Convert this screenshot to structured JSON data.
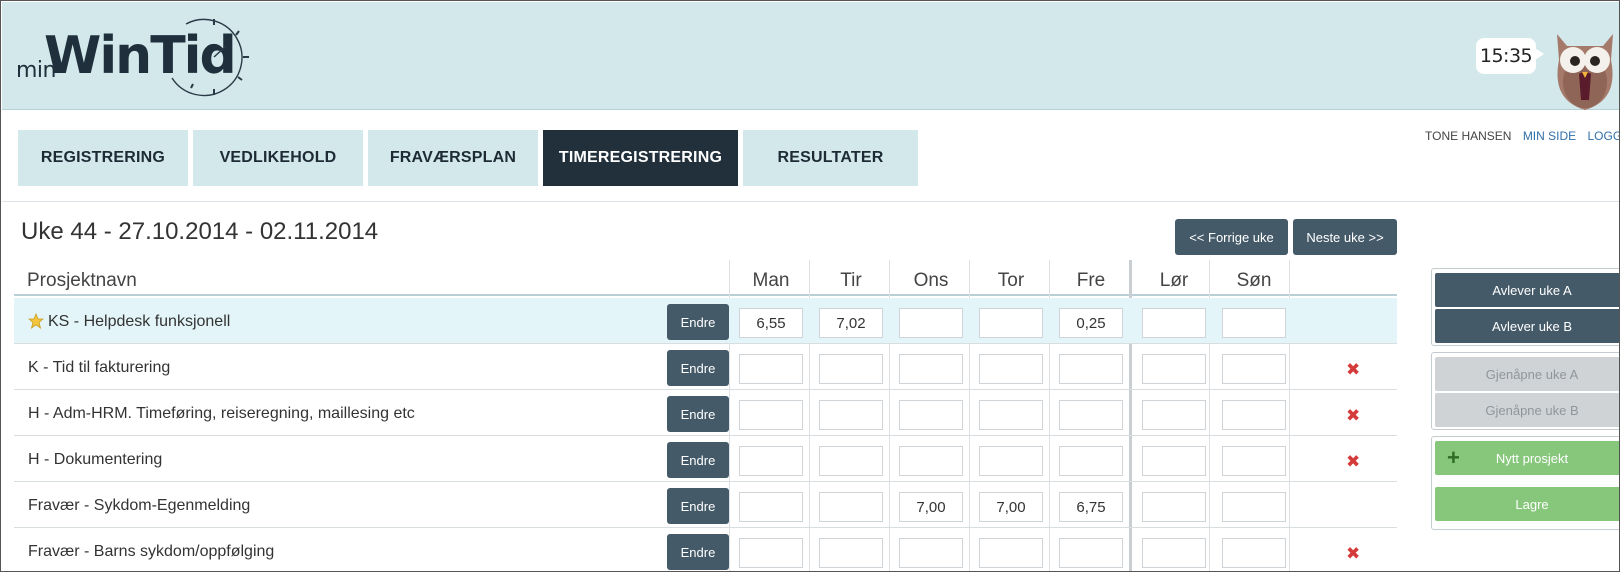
{
  "header": {
    "logo_min": "min",
    "logo_wintid": "WinTid",
    "clock": "15:35"
  },
  "nav": {
    "tabs": [
      {
        "label": "REGISTRERING",
        "active": false
      },
      {
        "label": "VEDLIKEHOLD",
        "active": false
      },
      {
        "label": "FRAVÆRSPLAN",
        "active": false
      },
      {
        "label": "TIMEREGISTRERING",
        "active": true
      },
      {
        "label": "RESULTATER",
        "active": false
      }
    ],
    "user": "TONE HANSEN",
    "min_side": "MIN SIDE",
    "logout": "LOGG UT"
  },
  "week": {
    "title": "Uke 44 - 27.10.2014 - 02.11.2014",
    "prev": "<< Forrige uke",
    "next": "Neste uke >>"
  },
  "grid": {
    "name_header": "Prosjektnavn",
    "days": [
      "Man",
      "Tir",
      "Ons",
      "Tor",
      "Fre",
      "Lør",
      "Søn"
    ],
    "edit_label": "Endre",
    "rows": [
      {
        "name": "KS - Helpdesk funksjonell",
        "favorite": true,
        "values": [
          "6,55",
          "7,02",
          "",
          "",
          "0,25",
          "",
          ""
        ],
        "deletable": false
      },
      {
        "name": "K - Tid til fakturering",
        "favorite": false,
        "values": [
          "",
          "",
          "",
          "",
          "",
          "",
          ""
        ],
        "deletable": true
      },
      {
        "name": "H - Adm-HRM. Timeføring, reiseregning, maillesing etc",
        "favorite": false,
        "values": [
          "",
          "",
          "",
          "",
          "",
          "",
          ""
        ],
        "deletable": true
      },
      {
        "name": "H - Dokumentering",
        "favorite": false,
        "values": [
          "",
          "",
          "",
          "",
          "",
          "",
          ""
        ],
        "deletable": true
      },
      {
        "name": "Fravær - Sykdom-Egenmelding",
        "favorite": false,
        "values": [
          "",
          "",
          "7,00",
          "7,00",
          "6,75",
          "",
          ""
        ],
        "deletable": false
      },
      {
        "name": "Fravær - Barns sykdom/oppfølging",
        "favorite": false,
        "values": [
          "",
          "",
          "",
          "",
          "",
          "",
          ""
        ],
        "deletable": true
      }
    ]
  },
  "side": {
    "deliver_a": "Avlever uke A",
    "deliver_b": "Avlever uke B",
    "reopen_a": "Gjenåpne uke A",
    "reopen_b": "Gjenåpne uke B",
    "new_project": "Nytt prosjekt",
    "save": "Lagre"
  },
  "colors": {
    "header_bg": "#d2e8eb",
    "active_tab": "#22303c",
    "button_dark": "#445a68",
    "button_green": "#86c77b",
    "delete_red": "#d63b3b"
  }
}
